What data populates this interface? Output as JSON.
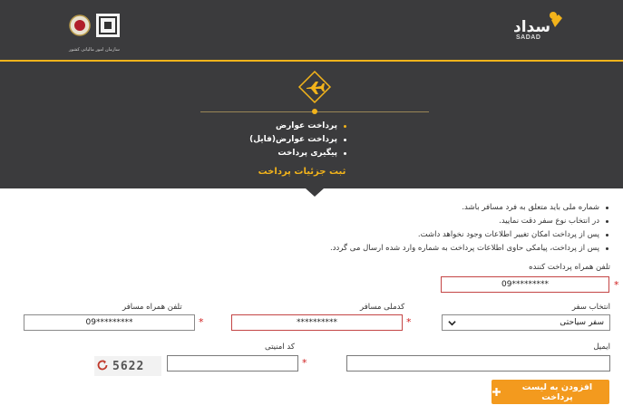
{
  "header": {
    "sadad_logo_text": "سداد",
    "sadad_logo_subtext": "SADAD",
    "bank_logo_caption": "سازمان امور مالیاتی کشور"
  },
  "banner": {
    "icon": "plane-icon",
    "menu": [
      {
        "label": "پرداخت عوارض",
        "active": true
      },
      {
        "label": "پرداخت عوارض(فایل)",
        "active": false
      },
      {
        "label": "پیگیری پرداخت",
        "active": false
      }
    ],
    "title": "ثبت جزئیات پرداخت"
  },
  "notes": [
    "شماره ملی باید متعلق به فرد مسافر باشد.",
    "در انتخاب نوع سفر دقت نمایید.",
    "پس از پرداخت امکان تغییر اطلاعات وجود نخواهد داشت.",
    "پس از پرداخت، پیامکی حاوی اطلاعات پرداخت به شماره وارد شده ارسال می گردد."
  ],
  "form": {
    "payer_phone": {
      "label": "تلفن همراه پرداخت کننده",
      "value": "09*********",
      "required": "*"
    },
    "travel_type": {
      "label": "انتخاب سفر",
      "value": "سفر سیاحتی"
    },
    "national_code": {
      "label": "کدملی مسافر",
      "value": "**********",
      "required": "*"
    },
    "passenger_phone": {
      "label": "تلفن همراه مسافر",
      "value": "09*********",
      "required": "*"
    },
    "email": {
      "label": "ایمیل",
      "value": ""
    },
    "security_code": {
      "label": "کد امنیتی",
      "value": "",
      "required": "*"
    },
    "captcha_text": "5622"
  },
  "add_button": {
    "label": "افزودن به لیست پرداخت"
  },
  "colors": {
    "accent": "#f2b31b",
    "button": "#f39a1e",
    "dark": "#3b3b3d",
    "error_border": "#c44545"
  }
}
